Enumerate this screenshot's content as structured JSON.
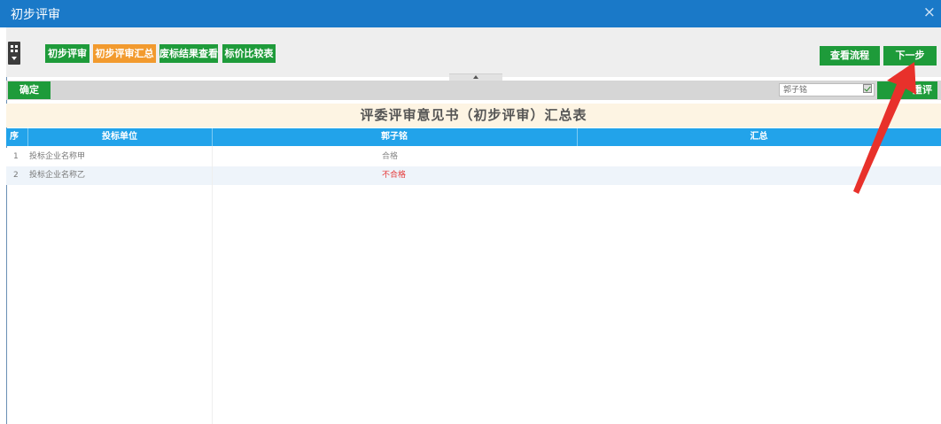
{
  "window": {
    "title": "初步评审",
    "close_glyph": "×"
  },
  "tabs": [
    {
      "label": "初步评审",
      "active": false
    },
    {
      "label": "初步评审汇总",
      "active": true
    },
    {
      "label": "废标结果查看",
      "active": false
    },
    {
      "label": "标价比较表",
      "active": false
    }
  ],
  "actions": {
    "view_process": "查看流程",
    "next_step": "下一步"
  },
  "bar": {
    "confirm": "确定",
    "reviewer": "郭子铭",
    "reevaluate": "重评"
  },
  "table": {
    "caption": "评委评审意见书（初步评审）汇总表",
    "headers": [
      "序",
      "投标单位",
      "郭子铭",
      "汇总"
    ],
    "rows": [
      {
        "index": "1",
        "bidder": "投标企业名称甲",
        "result": "合格",
        "result_status": "pass"
      },
      {
        "index": "2",
        "bidder": "投标企业名称乙",
        "result": "不合格",
        "result_status": "fail"
      }
    ]
  },
  "colors": {
    "accent": "#1a79c8",
    "green": "#1e9b3a",
    "orange": "#f29a2e",
    "header": "#22a3ea",
    "annotation": "#e8312b"
  },
  "icons": {
    "grid": "grid-menu-icon",
    "check": "checkbox-checked-icon",
    "arrow": "red-annotation-arrow"
  }
}
